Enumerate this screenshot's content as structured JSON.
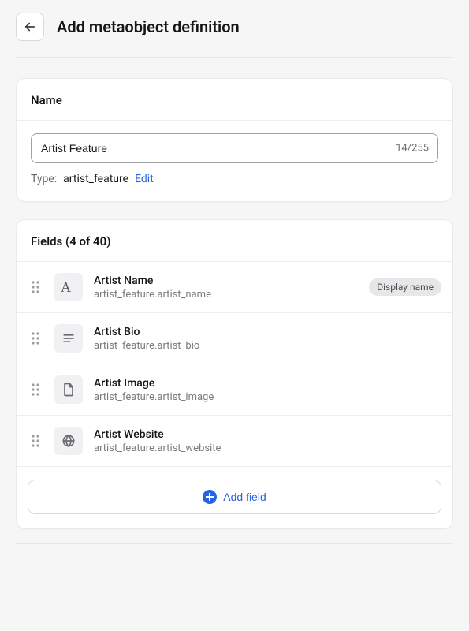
{
  "header": {
    "title": "Add metaobject definition"
  },
  "name_card": {
    "section_label": "Name",
    "value": "Artist Feature",
    "char_count": "14/255",
    "type_label": "Type:",
    "type_value": "artist_feature",
    "edit_label": "Edit"
  },
  "fields_card": {
    "section_label": "Fields (4 of 40)",
    "add_button_label": "Add field",
    "items": [
      {
        "name": "Artist Name",
        "key": "artist_feature.artist_name",
        "badge": "Display name",
        "icon": "text-a-icon"
      },
      {
        "name": "Artist Bio",
        "key": "artist_feature.artist_bio",
        "badge": null,
        "icon": "paragraph-icon"
      },
      {
        "name": "Artist Image",
        "key": "artist_feature.artist_image",
        "badge": null,
        "icon": "file-icon"
      },
      {
        "name": "Artist Website",
        "key": "artist_feature.artist_website",
        "badge": null,
        "icon": "globe-icon"
      }
    ]
  }
}
